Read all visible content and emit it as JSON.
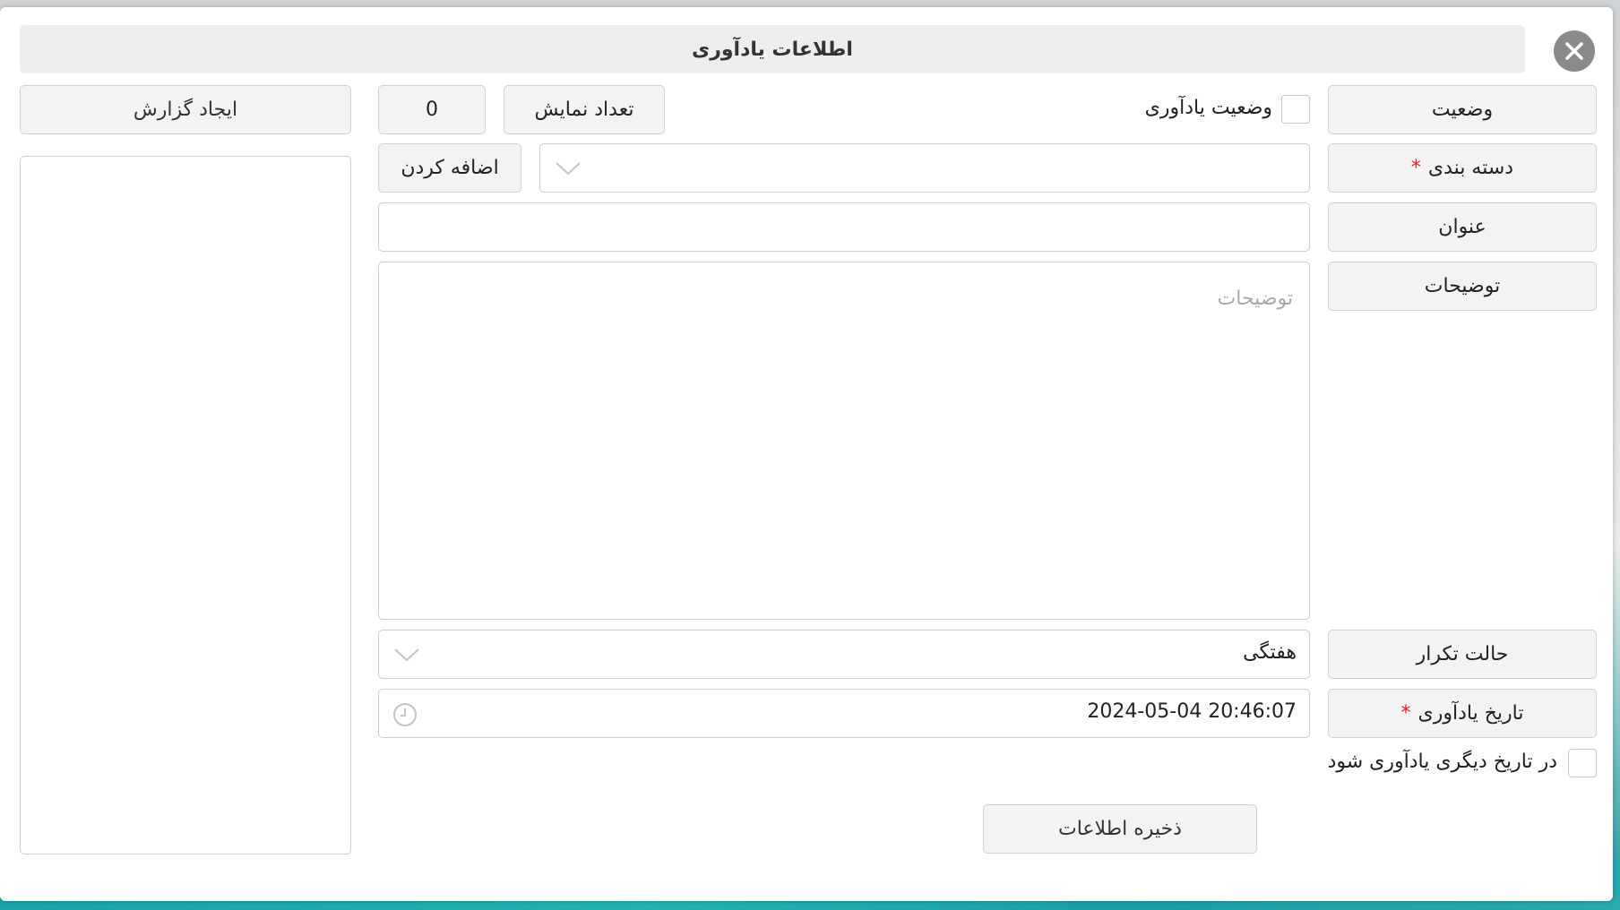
{
  "dialog": {
    "title": "اطلاعات یادآوری",
    "close_icon": "close-icon"
  },
  "left_panel": {
    "create_report_label": "ایجاد گزارش"
  },
  "form": {
    "status_label": "وضعیت",
    "reminder_status_label": "وضعیت یادآوری",
    "display_count_label": "تعداد نمایش",
    "display_count_value": "0",
    "category_label": "دسته بندی",
    "required_mark": "*",
    "add_button_label": "اضافه کردن",
    "title_label": "عنوان",
    "title_value": "",
    "description_label": "توضیحات",
    "description_placeholder": "توضیحات",
    "repeat_mode_label": "حالت تکرار",
    "repeat_mode_value": "هفتگی",
    "reminder_date_label": "تاریخ یادآوری",
    "reminder_date_value": "2024-05-04 20:46:07",
    "remind_other_date_label": "در تاریخ دیگری یادآوری شود",
    "save_button_label": "ذخیره اطلاعات"
  },
  "icons": {
    "dropdown": "chevron-down-icon",
    "clock": "clock-icon"
  },
  "colors": {
    "required": "#e02020",
    "button_bg": "#f3f3f3",
    "close_bg": "#8a8a8a"
  }
}
